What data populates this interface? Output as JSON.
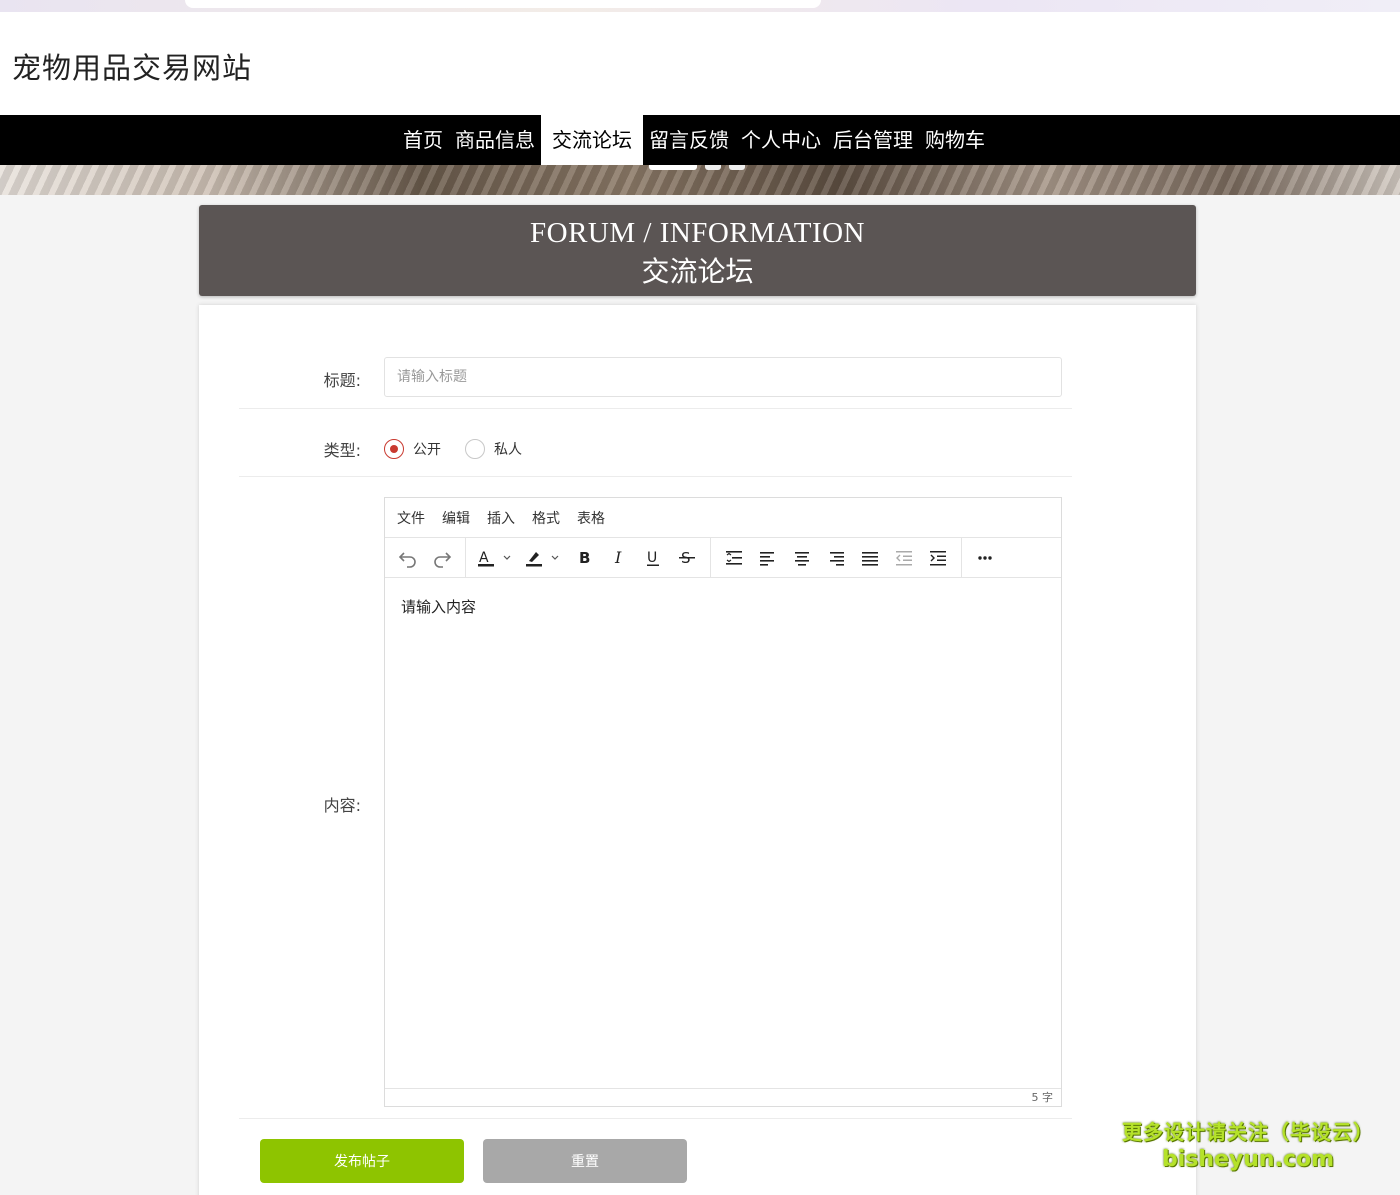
{
  "site": {
    "title": "宠物用品交易网站"
  },
  "nav": {
    "items": [
      {
        "label": "首页"
      },
      {
        "label": "商品信息"
      },
      {
        "label": "交流论坛",
        "active": true
      },
      {
        "label": "留言反馈"
      },
      {
        "label": "个人中心"
      },
      {
        "label": "后台管理"
      },
      {
        "label": "购物车"
      }
    ]
  },
  "section": {
    "title_en": "FORUM / INFORMATION",
    "title_cn": "交流论坛"
  },
  "form": {
    "title_label": "标题:",
    "title_placeholder": "请输入标题",
    "type_label": "类型:",
    "type_options": [
      {
        "label": "公开",
        "checked": true
      },
      {
        "label": "私人",
        "checked": false
      }
    ],
    "content_label": "内容:",
    "submit_label": "发布帖子",
    "reset_label": "重置"
  },
  "editor": {
    "menus": [
      "文件",
      "编辑",
      "插入",
      "格式",
      "表格"
    ],
    "placeholder_text": "请输入内容",
    "char_count": "5 字",
    "toolbar_icons": [
      "undo-icon",
      "redo-icon",
      "text-color-icon",
      "highlight-color-icon",
      "bold-icon",
      "italic-icon",
      "underline-icon",
      "strikethrough-icon",
      "line-height-icon",
      "align-left-icon",
      "align-center-icon",
      "align-right-icon",
      "align-justify-icon",
      "outdent-icon",
      "indent-icon",
      "more-icon"
    ]
  },
  "watermark": {
    "line1": "更多设计请关注（毕设云）",
    "line2": "bisheyun.com"
  },
  "colors": {
    "accent_red": "#c93a30",
    "submit_green": "#8ec400",
    "reset_gray": "#a8a8a8",
    "section_bg": "#5b5554",
    "nav_bg": "#000000"
  }
}
